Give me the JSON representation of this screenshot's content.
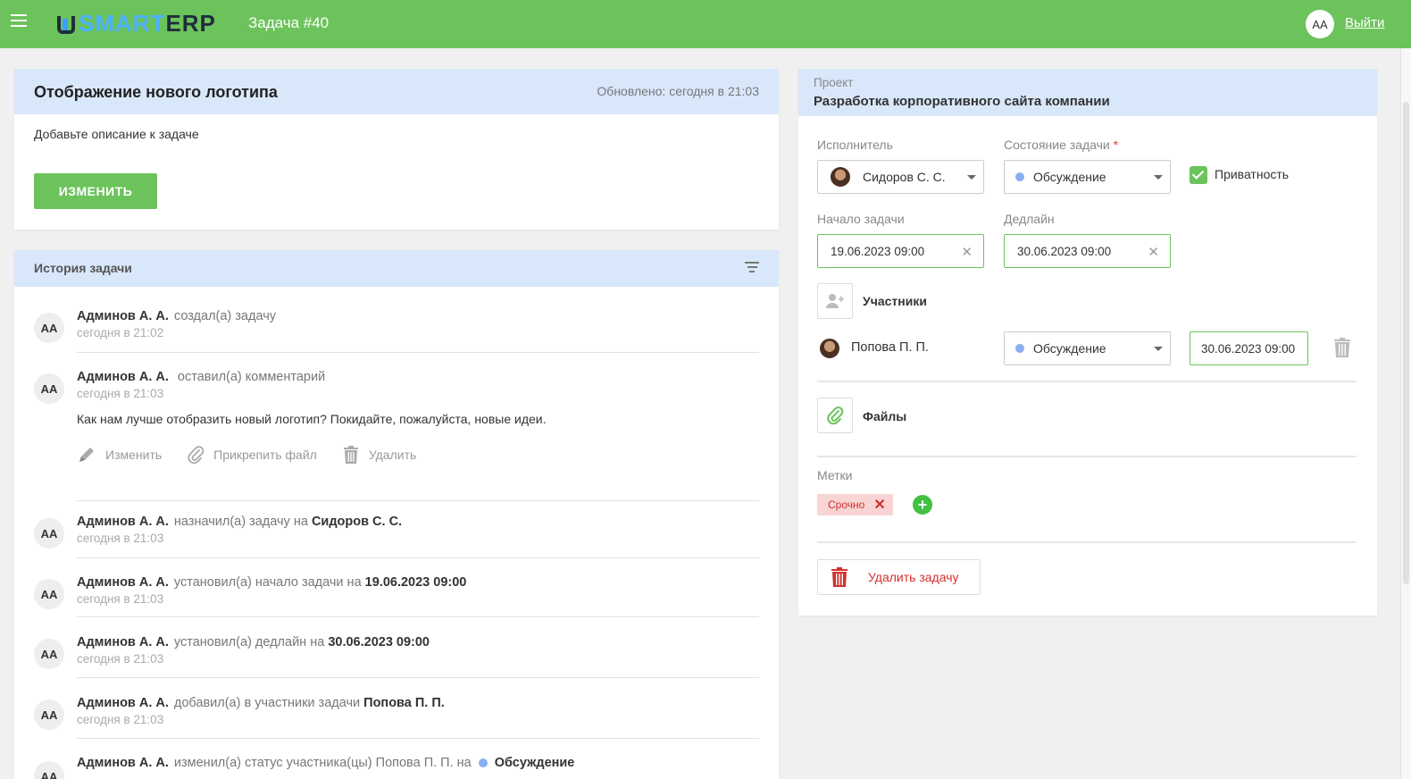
{
  "header": {
    "logo_part1": "SMART",
    "logo_part2": "ERP",
    "title": "Задача #40",
    "avatar_initials": "AA",
    "logout_label": "Выйти"
  },
  "task": {
    "title": "Отображение нового логотипа",
    "updated": "Обновлено: сегодня в 21:03",
    "description": "Добавьте описание к задаче",
    "edit_label": "ИЗМЕНИТЬ"
  },
  "history": {
    "title": "История задачи",
    "entries": [
      {
        "avatar": "AA",
        "author": "Админов А. А.",
        "action": "создал(а) задачу",
        "time": "сегодня в 21:02"
      },
      {
        "avatar": "AA",
        "author": "Админов А. А.",
        "action": "оставил(а) комментарий",
        "time": "сегодня в 21:03",
        "comment": "Как нам лучше отобразить новый логотип? Покидайте, пожалуйста, новые идеи.",
        "actions": {
          "edit": "Изменить",
          "attach": "Прикрепить файл",
          "delete": "Удалить"
        }
      },
      {
        "avatar": "AA",
        "author": "Админов А. А.",
        "action": "назначил(а) задачу на",
        "target": "Сидоров С. С.",
        "time": "сегодня в 21:03"
      },
      {
        "avatar": "AA",
        "author": "Админов А. А.",
        "action": "установил(а) начало задачи на",
        "target": "19.06.2023 09:00",
        "time": "сегодня в 21:03"
      },
      {
        "avatar": "AA",
        "author": "Админов А. А.",
        "action": "установил(а) дедлайн на",
        "target": "30.06.2023 09:00",
        "time": "сегодня в 21:03"
      },
      {
        "avatar": "AA",
        "author": "Админов А. А.",
        "action": "добавил(а) в участники задачи",
        "target": "Попова П. П.",
        "time": "сегодня в 21:03"
      },
      {
        "avatar": "AA",
        "author": "Админов А. А.",
        "action": "изменил(а) статус участника(цы) Попова П. П. на",
        "target": "Обсуждение"
      }
    ]
  },
  "project": {
    "label": "Проект",
    "name": "Разработка корпоративного сайта компании"
  },
  "fields": {
    "assignee_label": "Исполнитель",
    "assignee_value": "Сидоров С. С.",
    "status_label": "Состояние задачи",
    "status_required": "*",
    "status_value": "Обсуждение",
    "privacy_label": "Приватность",
    "privacy_checked": true,
    "start_label": "Начало задачи",
    "start_value": "19.06.2023 09:00",
    "deadline_label": "Дедлайн",
    "deadline_value": "30.06.2023 09:00"
  },
  "participants": {
    "label": "Участники",
    "items": [
      {
        "name": "Попова П. П.",
        "status": "Обсуждение",
        "deadline": "30.06.2023 09:00"
      }
    ]
  },
  "files": {
    "label": "Файлы"
  },
  "tags": {
    "label": "Метки",
    "items": [
      "Срочно"
    ]
  },
  "delete_task_label": "Удалить задачу",
  "colors": {
    "accent_green": "#6cc35b",
    "header_blue": "#d9e7fa",
    "status_dot": "#8aaef2",
    "danger": "#d32f2f"
  }
}
